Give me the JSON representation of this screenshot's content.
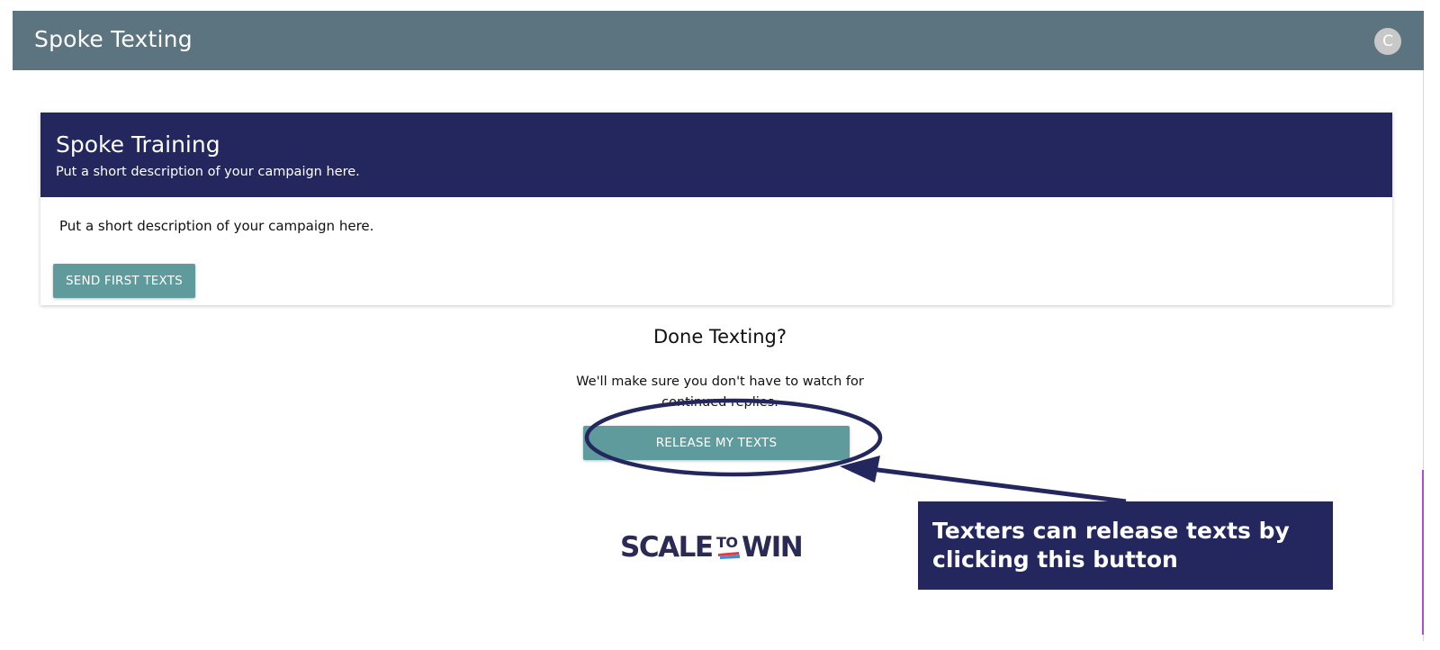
{
  "app": {
    "title": "Spoke Texting",
    "avatar_initial": "C"
  },
  "campaign": {
    "title": "Spoke Training",
    "subtitle": "Put a short description of your campaign here.",
    "body": "Put a short description of your campaign here.",
    "send_button_label": "SEND FIRST TEXTS"
  },
  "done": {
    "title": "Done Texting?",
    "description": "We'll make sure you don't have to watch for continued replies.",
    "release_button_label": "RELEASE MY TEXTS"
  },
  "logo": {
    "part1": "SCALE",
    "part2": "TO",
    "part3": "WIN"
  },
  "annotation": {
    "callout_text": "Texters can release texts by clicking this button",
    "color": "#23275d"
  },
  "colors": {
    "topbar": "#5c7480",
    "header": "#23275d",
    "button": "#5f9a9c",
    "avatar": "#c8c8c8"
  }
}
